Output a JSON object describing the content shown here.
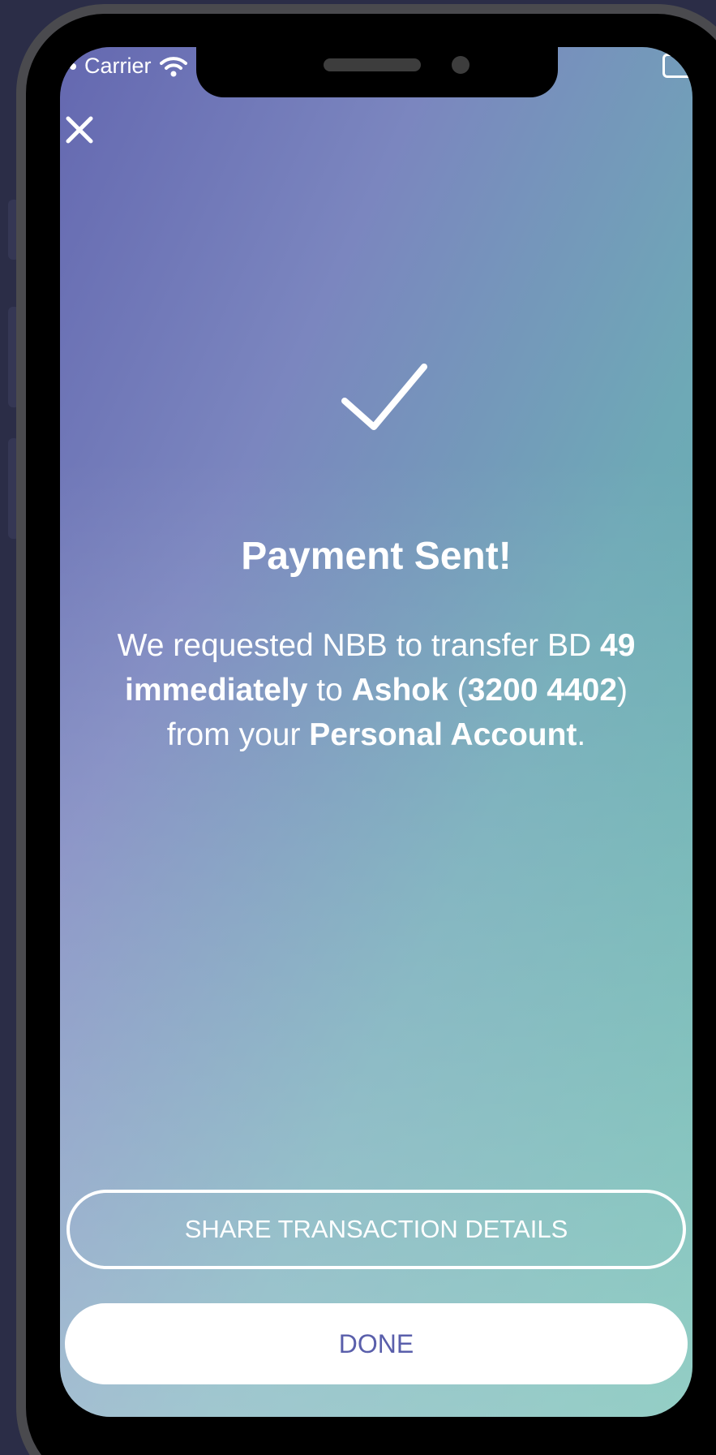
{
  "status_bar": {
    "carrier": "Carrier"
  },
  "header": {
    "close_icon": "close-icon"
  },
  "success_icon": "checkmark-icon",
  "title": "Payment Sent!",
  "message": {
    "part1": "We requested NBB to transfer BD ",
    "amount": "49",
    "timing": "immediately",
    "part2": " to ",
    "recipient": "Ashok",
    "paren_open": " (",
    "recipient_number": "3200 4402",
    "paren_close": ")",
    "part3": " from your ",
    "account": "Personal Account",
    "period": "."
  },
  "actions": {
    "share_label": "SHARE TRANSACTION DETAILS",
    "done_label": "DONE"
  },
  "colors": {
    "gradient_start": "#6468b0",
    "gradient_end": "#5ab4a6",
    "done_text": "#5a5fab"
  }
}
